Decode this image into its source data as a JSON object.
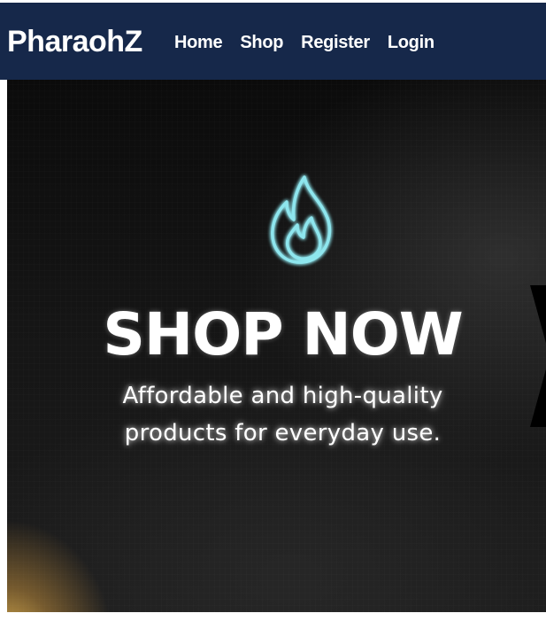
{
  "header": {
    "brand": "PharaohZ",
    "nav": [
      {
        "label": "Home"
      },
      {
        "label": "Shop"
      },
      {
        "label": "Register"
      },
      {
        "label": "Login"
      }
    ]
  },
  "hero": {
    "icon": "flame-icon",
    "title": "SHOP NOW",
    "subtitle_line1": "Affordable and high-quality",
    "subtitle_line2": "products for everyday use."
  },
  "colors": {
    "navbar_bg": "#16284a",
    "nav_text": "#ffffff",
    "hero_bg": "#111111",
    "flame_glow": "#8ee6ee",
    "gold_glow": "#e8b952"
  }
}
